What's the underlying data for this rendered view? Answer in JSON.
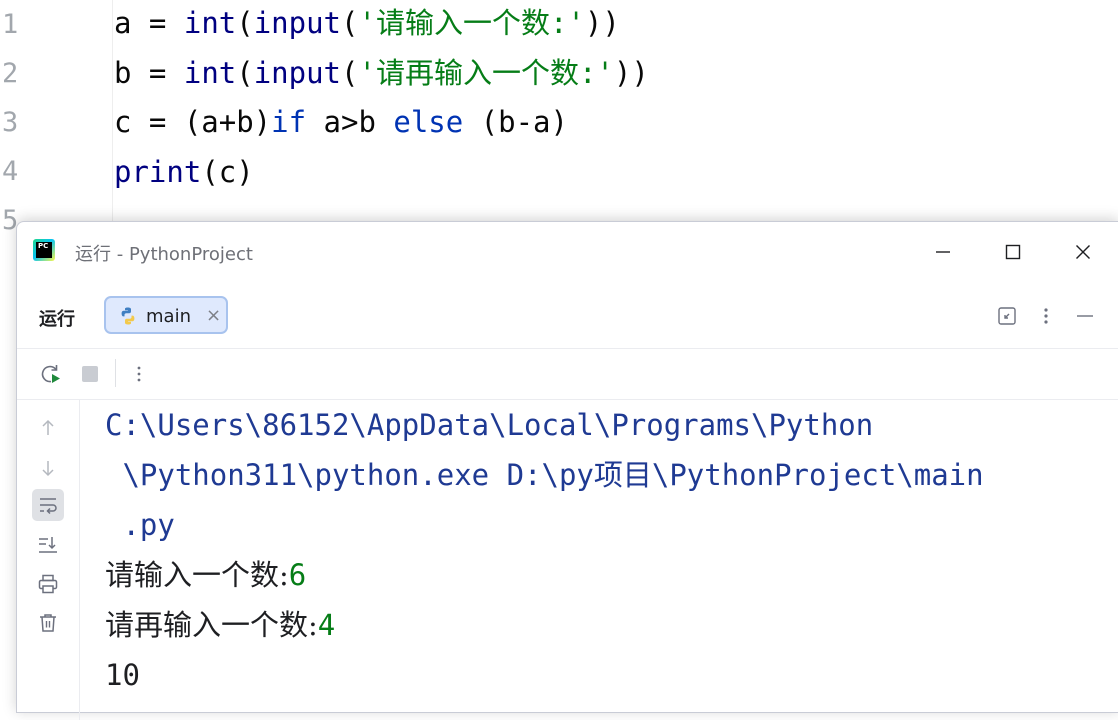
{
  "editor": {
    "line_numbers": [
      "1",
      "2",
      "3",
      "4",
      "5"
    ],
    "lines": [
      {
        "var": "a",
        "eq": " = ",
        "fn1": "int",
        "p1": "(",
        "fn2": "input",
        "p2": "(",
        "str": "'请输入一个数:'",
        "close": "))"
      },
      {
        "var": "b",
        "eq": " = ",
        "fn1": "int",
        "p1": "(",
        "fn2": "input",
        "p2": "(",
        "str": "'请再输入一个数:'",
        "close": "))"
      },
      {
        "pre": "c = (a+b)",
        "kw1": "if",
        "mid": " a>b ",
        "kw2": "else",
        "post": " (b-a)"
      },
      {
        "fn": "print",
        "args": "(c)"
      }
    ]
  },
  "run_window": {
    "title": "运行 - PythonProject",
    "tool_label": "运行",
    "tab_label": "main",
    "tab_close": "×",
    "console": {
      "path_line1": "C:\\Users\\86152\\AppData\\Local\\Programs\\Python",
      "path_line2": " \\Python311\\python.exe D:\\py项目\\PythonProject\\main",
      "path_line3": " .py",
      "prompt1": "请输入一个数:",
      "input1": "6",
      "prompt2": "请再输入一个数:",
      "input2": "4",
      "output": "10"
    }
  },
  "icons": {
    "app": "pycharm-icon",
    "tab": "python-icon",
    "window_controls": [
      "minimize-icon",
      "maximize-icon",
      "close-icon"
    ],
    "header": [
      "restore-layout-icon",
      "more-vertical-icon",
      "hide-icon"
    ],
    "toolbar": [
      "rerun-icon",
      "stop-icon",
      "more-vertical-icon"
    ],
    "side": [
      "scroll-up-icon",
      "scroll-down-icon",
      "soft-wrap-icon",
      "scroll-to-end-icon",
      "print-icon",
      "trash-icon"
    ]
  },
  "colors": {
    "keyword": "#0033b3",
    "string": "#067d17",
    "path": "#1f3a93",
    "tab_bg": "#dfe9fd",
    "tab_border": "#a8c3ee"
  }
}
